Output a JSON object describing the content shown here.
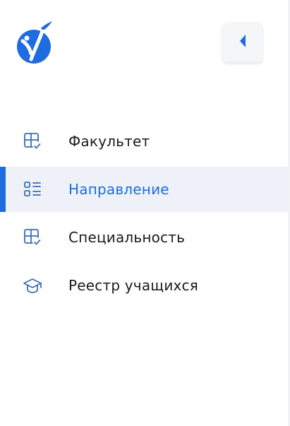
{
  "sidebar": {
    "logo_icon": "brand-logo-icon",
    "collapse_icon": "chevron-left-icon",
    "items": [
      {
        "label": "Факультет",
        "icon": "grid-check-icon",
        "active": false
      },
      {
        "label": "Направление",
        "icon": "list-icon",
        "active": true
      },
      {
        "label": "Специальность",
        "icon": "grid-check-icon",
        "active": false
      },
      {
        "label": "Реестр учащихся",
        "icon": "graduation-cap-icon",
        "active": false
      }
    ]
  },
  "colors": {
    "accent": "#1f6be0",
    "active_bg": "#eef2f8",
    "text": "#1b1b1b",
    "icon": "#3a6fb0"
  }
}
